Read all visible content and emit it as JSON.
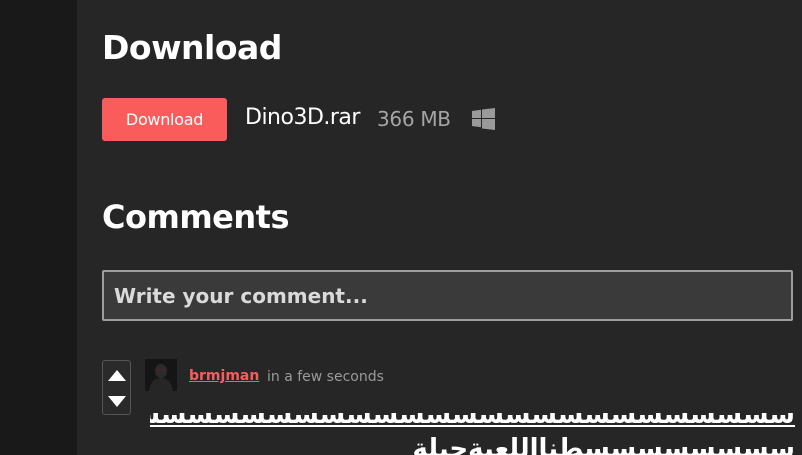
{
  "download_section": {
    "heading": "Download",
    "button_label": "Download",
    "file_name": "Dino3D.rar",
    "file_size": "366 MB",
    "platform_icon": "windows-icon"
  },
  "comments_section": {
    "heading": "Comments",
    "input_placeholder": "Write your comment..."
  },
  "comments": [
    {
      "username": "brmjman",
      "time": "in a few seconds",
      "line1": "سسسسسسسسسسسسسسسسسسسسسسسسسسسسسسسسسسس",
      "line2": "سسسسسسسسطنااللعبةحيلة"
    }
  ],
  "colors": {
    "accent": "#fa5c5c",
    "background": "#262626",
    "rail": "#191919"
  }
}
